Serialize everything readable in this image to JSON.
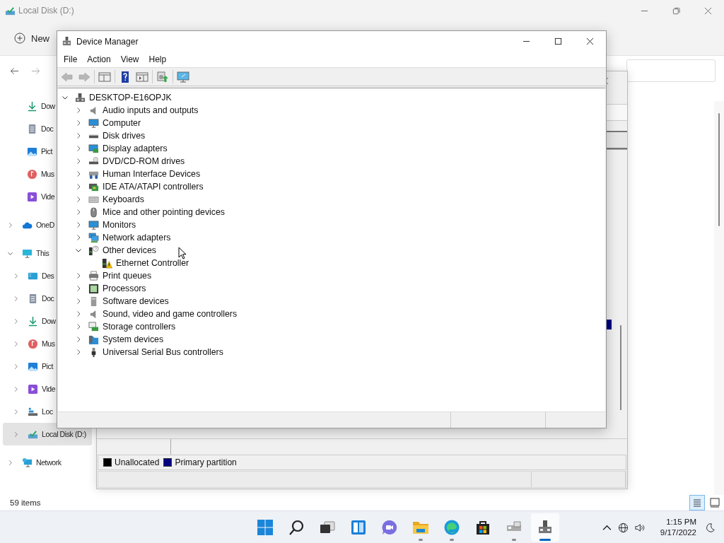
{
  "explorer": {
    "title": "Local Disk (D:)",
    "new_label": "New",
    "status": "59 items",
    "sidebar": [
      {
        "label": "Dow",
        "kind": "download",
        "pinned": true
      },
      {
        "label": "Doc",
        "kind": "document",
        "pinned": true
      },
      {
        "label": "Pict",
        "kind": "picture",
        "pinned": true
      },
      {
        "label": "Mus",
        "kind": "music",
        "pinned": true
      },
      {
        "label": "Vide",
        "kind": "video",
        "pinned": true
      },
      {
        "label": "OneD",
        "kind": "cloud",
        "expanded": false,
        "selected": false
      },
      {
        "label": "This",
        "kind": "pc",
        "expanded": true,
        "selected": false,
        "children": [
          {
            "label": "Des",
            "kind": "desktop",
            "expanded": false,
            "selected": false
          },
          {
            "label": "Doc",
            "kind": "document",
            "expanded": false,
            "selected": false
          },
          {
            "label": "Dow",
            "kind": "download",
            "expanded": false,
            "selected": false
          },
          {
            "label": "Mus",
            "kind": "music",
            "expanded": false,
            "selected": false
          },
          {
            "label": "Pict",
            "kind": "picture",
            "expanded": false,
            "selected": false
          },
          {
            "label": "Vide",
            "kind": "video",
            "expanded": false,
            "selected": false
          },
          {
            "label": "Loc",
            "kind": "disk",
            "expanded": false,
            "selected": false
          },
          {
            "label": "Local Disk (D:)",
            "kind": "disk-d",
            "expanded": false,
            "selected": true
          }
        ]
      },
      {
        "label": "Network",
        "kind": "network",
        "expanded": false,
        "selected": false
      }
    ],
    "views": [
      {
        "kind": "details",
        "selected": true
      },
      {
        "kind": "tiles",
        "selected": false
      }
    ]
  },
  "disk_management": {
    "legend": [
      {
        "label": "Unallocated",
        "color": "#000000"
      },
      {
        "label": "Primary partition",
        "color": "#000080"
      }
    ]
  },
  "device_manager": {
    "title": "Device Manager",
    "menu": [
      "File",
      "Action",
      "View",
      "Help"
    ],
    "toolbar": [
      {
        "kind": "back",
        "disabled": true
      },
      {
        "kind": "forward",
        "disabled": true
      },
      {
        "kind": "console",
        "disabled": false
      },
      {
        "kind": "help",
        "disabled": false
      },
      {
        "kind": "pane",
        "disabled": false
      },
      {
        "kind": "update",
        "disabled": false
      },
      {
        "kind": "scan",
        "disabled": false
      }
    ],
    "tree": {
      "label": "DESKTOP-E16OPJK",
      "kind": "computer",
      "expanded": true,
      "children": [
        {
          "label": "Audio inputs and outputs",
          "kind": "speaker",
          "expanded": false
        },
        {
          "label": "Computer",
          "kind": "monitor",
          "expanded": false
        },
        {
          "label": "Disk drives",
          "kind": "drive",
          "expanded": false
        },
        {
          "label": "Display adapters",
          "kind": "display",
          "expanded": false
        },
        {
          "label": "DVD/CD-ROM drives",
          "kind": "dvd",
          "expanded": false
        },
        {
          "label": "Human Interface Devices",
          "kind": "hid",
          "expanded": false
        },
        {
          "label": "IDE ATA/ATAPI controllers",
          "kind": "card",
          "expanded": false
        },
        {
          "label": "Keyboards",
          "kind": "keyboard",
          "expanded": false
        },
        {
          "label": "Mice and other pointing devices",
          "kind": "mouse",
          "expanded": false
        },
        {
          "label": "Monitors",
          "kind": "monitor",
          "expanded": false
        },
        {
          "label": "Network adapters",
          "kind": "network",
          "expanded": false
        },
        {
          "label": "Other devices",
          "kind": "other",
          "expanded": true,
          "children": [
            {
              "label": "Ethernet Controller",
              "kind": "warning"
            }
          ]
        },
        {
          "label": "Print queues",
          "kind": "printer",
          "expanded": false
        },
        {
          "label": "Processors",
          "kind": "cpu",
          "expanded": false
        },
        {
          "label": "Software devices",
          "kind": "software",
          "expanded": false
        },
        {
          "label": "Sound, video and game controllers",
          "kind": "speaker",
          "expanded": false
        },
        {
          "label": "Storage controllers",
          "kind": "storage",
          "expanded": false
        },
        {
          "label": "System devices",
          "kind": "system",
          "expanded": false
        },
        {
          "label": "Universal Serial Bus controllers",
          "kind": "usb",
          "expanded": false
        }
      ]
    }
  },
  "taskbar": {
    "apps": [
      {
        "kind": "start",
        "running": false,
        "selected": false
      },
      {
        "kind": "search",
        "running": false,
        "selected": false
      },
      {
        "kind": "taskview",
        "running": false,
        "selected": false
      },
      {
        "kind": "widgets",
        "running": false,
        "selected": false
      },
      {
        "kind": "chat",
        "running": false,
        "selected": false
      },
      {
        "kind": "explorer",
        "running": true,
        "selected": false
      },
      {
        "kind": "edge",
        "running": true,
        "selected": false
      },
      {
        "kind": "store",
        "running": false,
        "selected": false
      },
      {
        "kind": "diskmgmt",
        "running": true,
        "selected": false
      },
      {
        "kind": "devmgr",
        "running": true,
        "selected": true
      }
    ],
    "time": "1:15 PM",
    "date": "9/17/2022"
  }
}
